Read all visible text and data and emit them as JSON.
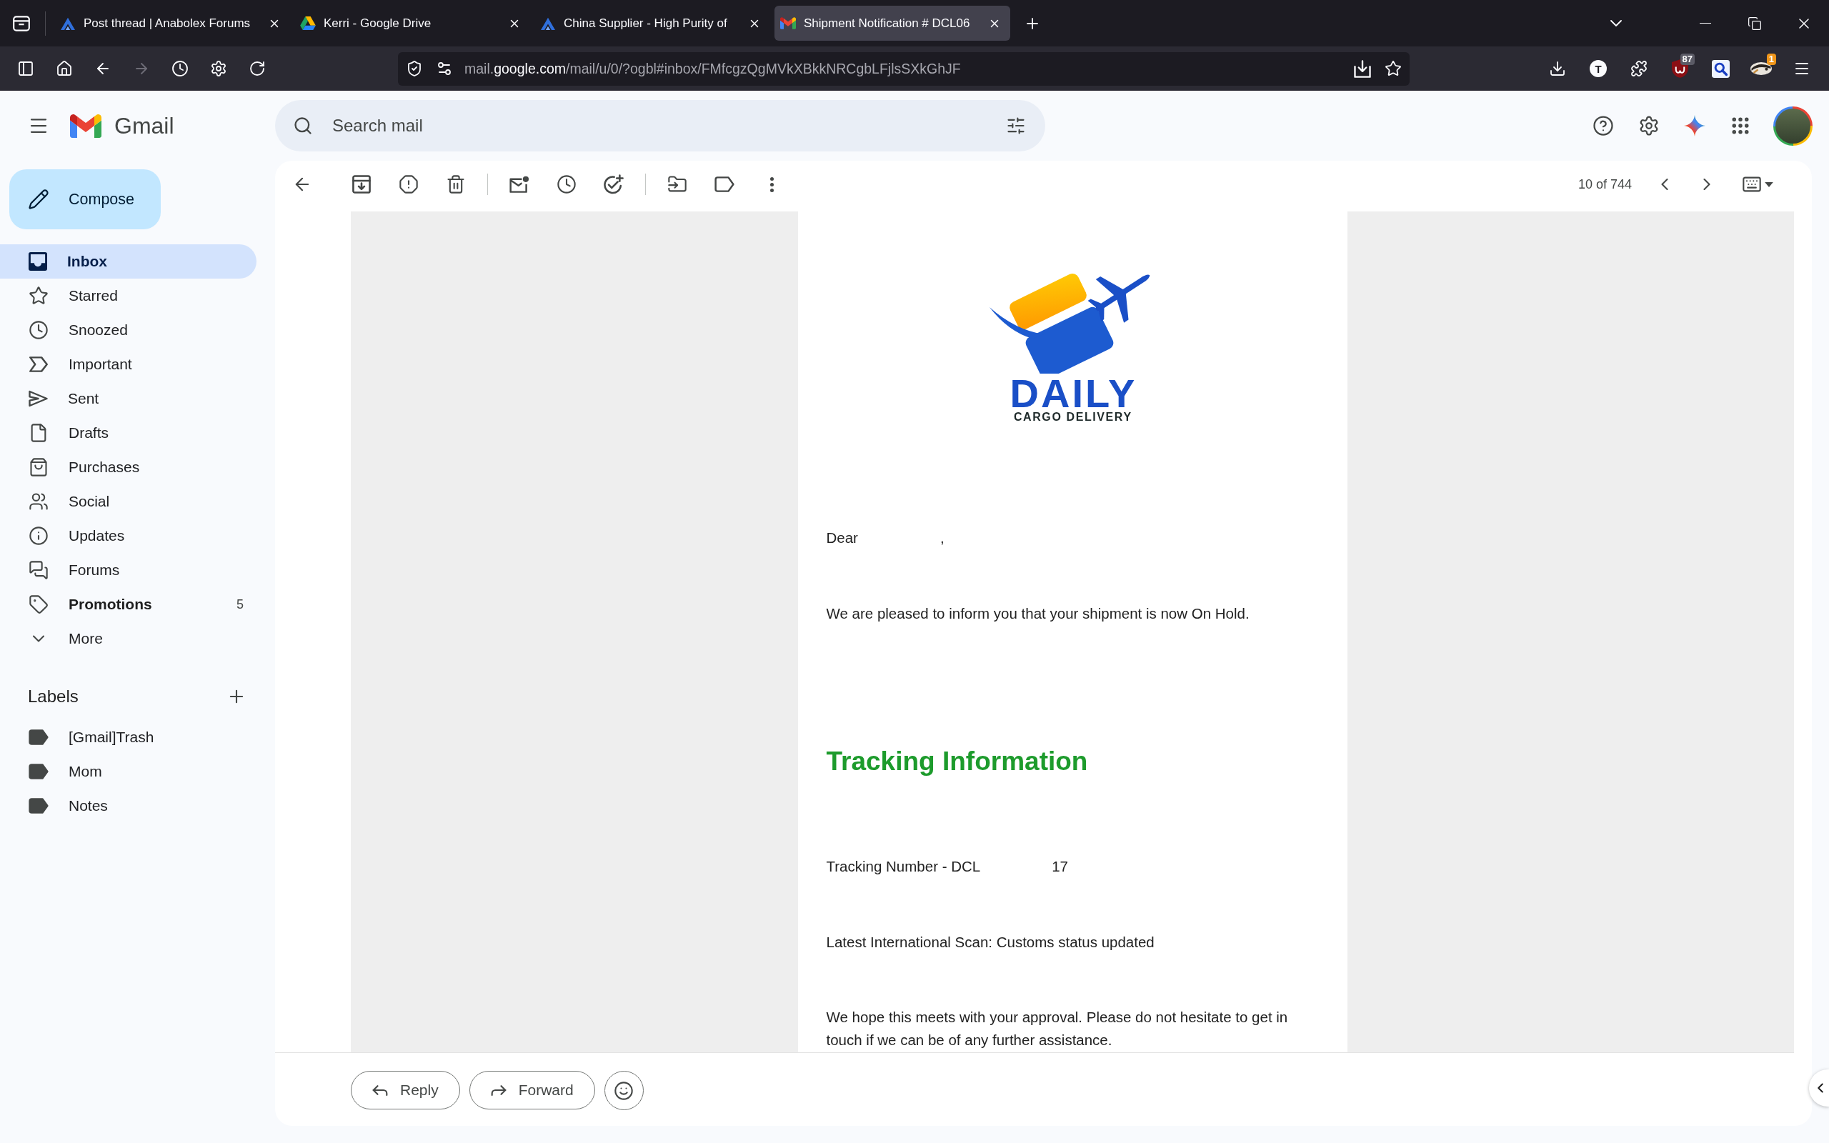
{
  "browser": {
    "tabs": [
      {
        "kind": "forum",
        "title": "Post thread | Anabolex Forums",
        "selected": false
      },
      {
        "kind": "drive",
        "title": "Kerri - Google Drive",
        "selected": false
      },
      {
        "kind": "forum",
        "title": "China Supplier - High Purity of",
        "selected": false
      },
      {
        "kind": "mail",
        "title": "Shipment Notification # DCL06",
        "selected": true
      }
    ],
    "nav_buttons": [
      {
        "kind": "sidebar",
        "disabled": false
      },
      {
        "kind": "home",
        "disabled": false
      },
      {
        "kind": "back",
        "disabled": false
      },
      {
        "kind": "forward",
        "disabled": true
      },
      {
        "kind": "history",
        "disabled": false
      },
      {
        "kind": "settings",
        "disabled": false
      },
      {
        "kind": "reload",
        "disabled": false
      }
    ],
    "address": {
      "prefix": "mail.",
      "domain": "google.com",
      "path": "/mail/u/0/?ogbl#inbox/FMfcgzQgMVkXBkkNRCgbLFjlsSXkGhJF"
    },
    "extensions": [
      {
        "kind": "download"
      },
      {
        "kind": "letter",
        "label": "T"
      },
      {
        "kind": "puzzle"
      },
      {
        "kind": "shield",
        "badge": "87"
      },
      {
        "kind": "lens"
      },
      {
        "kind": "badger",
        "badge": "1"
      },
      {
        "kind": "menu"
      }
    ]
  },
  "gmail": {
    "app_name": "Gmail",
    "search": {
      "placeholder": "Search mail"
    },
    "compose": "Compose",
    "nav": [
      {
        "kind": "inbox",
        "label": "Inbox",
        "selected": true,
        "unread": false
      },
      {
        "kind": "starred",
        "label": "Starred",
        "selected": false,
        "unread": false
      },
      {
        "kind": "snoozed",
        "label": "Snoozed",
        "selected": false,
        "unread": false
      },
      {
        "kind": "important",
        "label": "Important",
        "selected": false,
        "unread": false
      },
      {
        "kind": "sent",
        "label": "Sent",
        "selected": false,
        "unread": false
      },
      {
        "kind": "drafts",
        "label": "Drafts",
        "selected": false,
        "unread": false
      },
      {
        "kind": "purchases",
        "label": "Purchases",
        "selected": false,
        "unread": false
      },
      {
        "kind": "social",
        "label": "Social",
        "selected": false,
        "unread": false
      },
      {
        "kind": "updates",
        "label": "Updates",
        "selected": false,
        "unread": false
      },
      {
        "kind": "forums",
        "label": "Forums",
        "selected": false,
        "unread": false
      },
      {
        "kind": "promotions",
        "label": "Promotions",
        "selected": false,
        "unread": true,
        "count": "5"
      },
      {
        "kind": "more",
        "label": "More",
        "selected": false,
        "unread": false
      }
    ],
    "labels_heading": "Labels",
    "labels": [
      {
        "name": "[Gmail]Trash"
      },
      {
        "name": "Mom"
      },
      {
        "name": "Notes"
      }
    ],
    "pager": "10 of 744",
    "message": {
      "logo": {
        "title": "DAILY",
        "subtitle": "CARGO DELIVERY"
      },
      "greeting": "Dear",
      "greeting_end": ",",
      "intro": "We are pleased to inform you that your shipment is now On Hold.",
      "heading": "Tracking Information",
      "tracking": {
        "label": "Tracking Number - DCL",
        "suffix": "17"
      },
      "scan": "Latest International Scan: Customs status updated",
      "closing": "We hope this meets with your approval. Please do not hesitate to get in touch if we can be of any further assistance."
    },
    "actions": [
      {
        "kind": "reply",
        "label": "Reply"
      },
      {
        "kind": "forward",
        "label": "Forward"
      },
      {
        "kind": "emoji"
      }
    ]
  }
}
